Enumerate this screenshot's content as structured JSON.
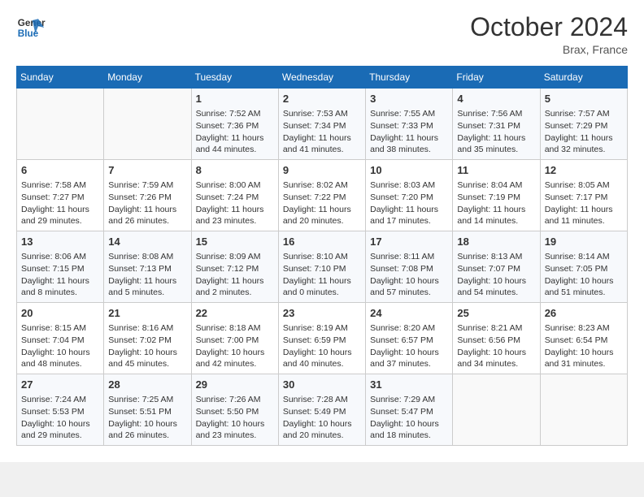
{
  "header": {
    "logo_line1": "General",
    "logo_line2": "Blue",
    "month_title": "October 2024",
    "location": "Brax, France"
  },
  "weekdays": [
    "Sunday",
    "Monday",
    "Tuesday",
    "Wednesday",
    "Thursday",
    "Friday",
    "Saturday"
  ],
  "weeks": [
    [
      {
        "day": "",
        "info": ""
      },
      {
        "day": "",
        "info": ""
      },
      {
        "day": "1",
        "info": "Sunrise: 7:52 AM\nSunset: 7:36 PM\nDaylight: 11 hours and 44 minutes."
      },
      {
        "day": "2",
        "info": "Sunrise: 7:53 AM\nSunset: 7:34 PM\nDaylight: 11 hours and 41 minutes."
      },
      {
        "day": "3",
        "info": "Sunrise: 7:55 AM\nSunset: 7:33 PM\nDaylight: 11 hours and 38 minutes."
      },
      {
        "day": "4",
        "info": "Sunrise: 7:56 AM\nSunset: 7:31 PM\nDaylight: 11 hours and 35 minutes."
      },
      {
        "day": "5",
        "info": "Sunrise: 7:57 AM\nSunset: 7:29 PM\nDaylight: 11 hours and 32 minutes."
      }
    ],
    [
      {
        "day": "6",
        "info": "Sunrise: 7:58 AM\nSunset: 7:27 PM\nDaylight: 11 hours and 29 minutes."
      },
      {
        "day": "7",
        "info": "Sunrise: 7:59 AM\nSunset: 7:26 PM\nDaylight: 11 hours and 26 minutes."
      },
      {
        "day": "8",
        "info": "Sunrise: 8:00 AM\nSunset: 7:24 PM\nDaylight: 11 hours and 23 minutes."
      },
      {
        "day": "9",
        "info": "Sunrise: 8:02 AM\nSunset: 7:22 PM\nDaylight: 11 hours and 20 minutes."
      },
      {
        "day": "10",
        "info": "Sunrise: 8:03 AM\nSunset: 7:20 PM\nDaylight: 11 hours and 17 minutes."
      },
      {
        "day": "11",
        "info": "Sunrise: 8:04 AM\nSunset: 7:19 PM\nDaylight: 11 hours and 14 minutes."
      },
      {
        "day": "12",
        "info": "Sunrise: 8:05 AM\nSunset: 7:17 PM\nDaylight: 11 hours and 11 minutes."
      }
    ],
    [
      {
        "day": "13",
        "info": "Sunrise: 8:06 AM\nSunset: 7:15 PM\nDaylight: 11 hours and 8 minutes."
      },
      {
        "day": "14",
        "info": "Sunrise: 8:08 AM\nSunset: 7:13 PM\nDaylight: 11 hours and 5 minutes."
      },
      {
        "day": "15",
        "info": "Sunrise: 8:09 AM\nSunset: 7:12 PM\nDaylight: 11 hours and 2 minutes."
      },
      {
        "day": "16",
        "info": "Sunrise: 8:10 AM\nSunset: 7:10 PM\nDaylight: 11 hours and 0 minutes."
      },
      {
        "day": "17",
        "info": "Sunrise: 8:11 AM\nSunset: 7:08 PM\nDaylight: 10 hours and 57 minutes."
      },
      {
        "day": "18",
        "info": "Sunrise: 8:13 AM\nSunset: 7:07 PM\nDaylight: 10 hours and 54 minutes."
      },
      {
        "day": "19",
        "info": "Sunrise: 8:14 AM\nSunset: 7:05 PM\nDaylight: 10 hours and 51 minutes."
      }
    ],
    [
      {
        "day": "20",
        "info": "Sunrise: 8:15 AM\nSunset: 7:04 PM\nDaylight: 10 hours and 48 minutes."
      },
      {
        "day": "21",
        "info": "Sunrise: 8:16 AM\nSunset: 7:02 PM\nDaylight: 10 hours and 45 minutes."
      },
      {
        "day": "22",
        "info": "Sunrise: 8:18 AM\nSunset: 7:00 PM\nDaylight: 10 hours and 42 minutes."
      },
      {
        "day": "23",
        "info": "Sunrise: 8:19 AM\nSunset: 6:59 PM\nDaylight: 10 hours and 40 minutes."
      },
      {
        "day": "24",
        "info": "Sunrise: 8:20 AM\nSunset: 6:57 PM\nDaylight: 10 hours and 37 minutes."
      },
      {
        "day": "25",
        "info": "Sunrise: 8:21 AM\nSunset: 6:56 PM\nDaylight: 10 hours and 34 minutes."
      },
      {
        "day": "26",
        "info": "Sunrise: 8:23 AM\nSunset: 6:54 PM\nDaylight: 10 hours and 31 minutes."
      }
    ],
    [
      {
        "day": "27",
        "info": "Sunrise: 7:24 AM\nSunset: 5:53 PM\nDaylight: 10 hours and 29 minutes."
      },
      {
        "day": "28",
        "info": "Sunrise: 7:25 AM\nSunset: 5:51 PM\nDaylight: 10 hours and 26 minutes."
      },
      {
        "day": "29",
        "info": "Sunrise: 7:26 AM\nSunset: 5:50 PM\nDaylight: 10 hours and 23 minutes."
      },
      {
        "day": "30",
        "info": "Sunrise: 7:28 AM\nSunset: 5:49 PM\nDaylight: 10 hours and 20 minutes."
      },
      {
        "day": "31",
        "info": "Sunrise: 7:29 AM\nSunset: 5:47 PM\nDaylight: 10 hours and 18 minutes."
      },
      {
        "day": "",
        "info": ""
      },
      {
        "day": "",
        "info": ""
      }
    ]
  ]
}
